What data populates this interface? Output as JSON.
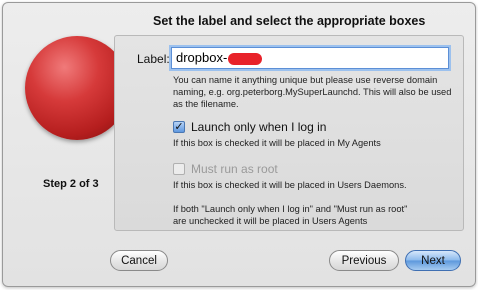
{
  "header": {
    "title": "Set the label and select the appropriate boxes"
  },
  "sidebar": {
    "step_text": "Step 2 of 3"
  },
  "form": {
    "label_caption": "Label:",
    "label_value": "dropbox-",
    "label_help": "You can name it anything unique but please use reverse domain naming, e.g. org.peterborg.MySuperLaunchd. This will also be used as the filename.",
    "launch_login": {
      "label": "Launch only when I log in",
      "checked": true,
      "enabled": true,
      "note": "If this box is checked it will be placed in My Agents"
    },
    "run_root": {
      "label": "Must run as root",
      "checked": false,
      "enabled": false,
      "note": "If this box is checked it will be placed in Users Daemons."
    },
    "both_note_line1": "If both \"Launch only when I log in\" and \"Must run as root\"",
    "both_note_line2": "are unchecked it will be placed in Users Agents"
  },
  "buttons": {
    "cancel": "Cancel",
    "previous": "Previous",
    "next": "Next"
  },
  "colors": {
    "accent": "#5c97dc",
    "redaction": "#e8222a",
    "sphere": "#c62a2a"
  }
}
